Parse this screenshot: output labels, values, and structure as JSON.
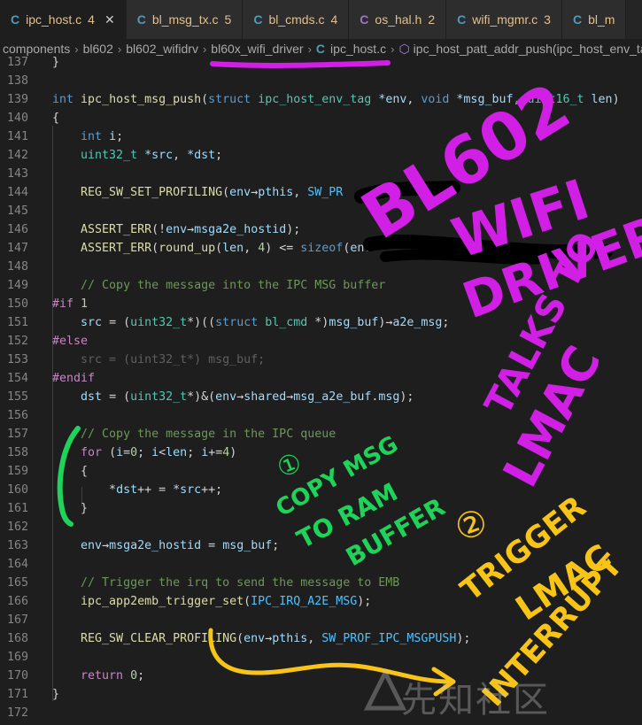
{
  "tabs": [
    {
      "label": "ipc_host.c",
      "count": "4",
      "icon": "c-file-icon",
      "active": true
    },
    {
      "label": "bl_msg_tx.c",
      "count": "5",
      "icon": "c-file-icon",
      "active": false
    },
    {
      "label": "bl_cmds.c",
      "count": "4",
      "icon": "c-file-icon",
      "active": false
    },
    {
      "label": "os_hal.h",
      "count": "2",
      "icon": "h-file-icon",
      "active": false
    },
    {
      "label": "wifi_mgmr.c",
      "count": "3",
      "icon": "c-file-icon",
      "active": false
    },
    {
      "label": "bl_m",
      "count": "",
      "icon": "c-file-icon",
      "active": false
    }
  ],
  "breadcrumb": [
    "components",
    "bl602",
    "bl602_wifidrv",
    "bl60x_wifi_driver",
    "ipc_host.c",
    "ipc_host_patt_addr_push(ipc_host_env_tag"
  ],
  "lines": [
    {
      "n": "137",
      "html": "}"
    },
    {
      "n": "138",
      "html": ""
    },
    {
      "n": "139",
      "html": "<span class='kw'>int</span> <span class='fn'>ipc_host_msg_push</span>(<span class='kw'>struct</span> <span class='ty'>ipc_host_env_tag</span> <span class='var'>*env</span>, <span class='kw'>void</span> <span class='var'>*msg_buf</span>, <span class='ty'>uint16_t</span> <span class='var'>len</span>)"
    },
    {
      "n": "140",
      "html": "{"
    },
    {
      "n": "141",
      "html": "    <span class='kw'>int</span> <span class='var'>i</span>;"
    },
    {
      "n": "142",
      "html": "    <span class='ty'>uint32_t</span> <span class='var'>*src</span>, <span class='var'>*dst</span>;"
    },
    {
      "n": "143",
      "html": ""
    },
    {
      "n": "144",
      "html": "    <span class='fn'>REG_SW_SET_PROFILING</span>(<span class='var'>env</span>→<span class='var'>pthis</span>, <span class='mac'>SW_PR</span>"
    },
    {
      "n": "145",
      "html": ""
    },
    {
      "n": "146",
      "html": "    <span class='fn'>ASSERT_ERR</span>(!<span class='var'>env</span>→<span class='var'>msga2e_hostid</span>);"
    },
    {
      "n": "147",
      "html": "    <span class='fn'>ASSERT_ERR</span>(<span class='fn'>round_up</span>(<span class='var'>len</span>, <span class='num'>4</span>) &lt;= <span class='kw'>sizeof</span>(<span class='var'>env</span>"
    },
    {
      "n": "148",
      "html": ""
    },
    {
      "n": "149",
      "html": "    <span class='cm'>// Copy the message into the IPC MSG buffer</span>"
    },
    {
      "n": "150",
      "html": "<span class='pp'>#if</span> <span class='num'>1</span>"
    },
    {
      "n": "151",
      "html": "    <span class='var'>src</span> = (<span class='ty'>uint32_t</span>*)((<span class='kw'>struct</span> <span class='ty'>bl_cmd</span> *)<span class='var'>msg_buf</span>)→<span class='var'>a2e_msg</span>;"
    },
    {
      "n": "152",
      "html": "<span class='pp'>#else</span>"
    },
    {
      "n": "153",
      "html": "    <span class='dim'>src = (uint32_t*) msg_buf;</span>"
    },
    {
      "n": "154",
      "html": "<span class='pp'>#endif</span>"
    },
    {
      "n": "155",
      "html": "    <span class='var'>dst</span> = (<span class='ty'>uint32_t</span>*)&amp;(<span class='var'>env</span>→<span class='var'>shared</span>→<span class='var'>msg_a2e_buf</span>.<span class='var'>msg</span>);"
    },
    {
      "n": "156",
      "html": ""
    },
    {
      "n": "157",
      "html": "    <span class='cm'>// Copy the message in the IPC queue</span>"
    },
    {
      "n": "158",
      "html": "    <span class='ctl'>for</span> (<span class='var'>i</span>=<span class='num'>0</span>; <span class='var'>i</span>&lt;<span class='var'>len</span>; <span class='var'>i</span>+=<span class='num'>4</span>)"
    },
    {
      "n": "159",
      "html": "    {"
    },
    {
      "n": "160",
      "html": "        *<span class='var'>dst</span>++ = *<span class='var'>src</span>++;"
    },
    {
      "n": "161",
      "html": "    }"
    },
    {
      "n": "162",
      "html": ""
    },
    {
      "n": "163",
      "html": "    <span class='var'>env</span>→<span class='var'>msga2e_hostid</span> = <span class='var'>msg_buf</span>;"
    },
    {
      "n": "164",
      "html": ""
    },
    {
      "n": "165",
      "html": "    <span class='cm'>// Trigger the irq to send the message to EMB</span>"
    },
    {
      "n": "166",
      "html": "    <span class='fn'>ipc_app2emb_trigger_set</span>(<span class='mac'>IPC_IRQ_A2E_MSG</span>);"
    },
    {
      "n": "167",
      "html": ""
    },
    {
      "n": "168",
      "html": "    <span class='fn'>REG_SW_CLEAR_PROFILING</span>(<span class='var'>env</span>→<span class='var'>pthis</span>, <span class='mac'>SW_PROF_IPC_MSGPUSH</span>);"
    },
    {
      "n": "169",
      "html": ""
    },
    {
      "n": "170",
      "html": "    <span class='ctl'>return</span> <span class='num'>0</span>;"
    },
    {
      "n": "171",
      "html": "}"
    },
    {
      "n": "172",
      "html": ""
    }
  ],
  "annotations": {
    "purple": [
      "BL602",
      "WIFI",
      "DRIVER",
      "TALKS TO",
      "LMAC"
    ],
    "green": [
      "①",
      "COPY MSG",
      "TO RAM",
      "BUFFER"
    ],
    "yellow": [
      "②",
      "TRIGGER",
      "LMAC",
      "INTERRUPT"
    ]
  },
  "watermark": "先知社区",
  "colors": {
    "purple": "#d21fe6",
    "green": "#1fd35a",
    "yellow": "#f7c417"
  }
}
